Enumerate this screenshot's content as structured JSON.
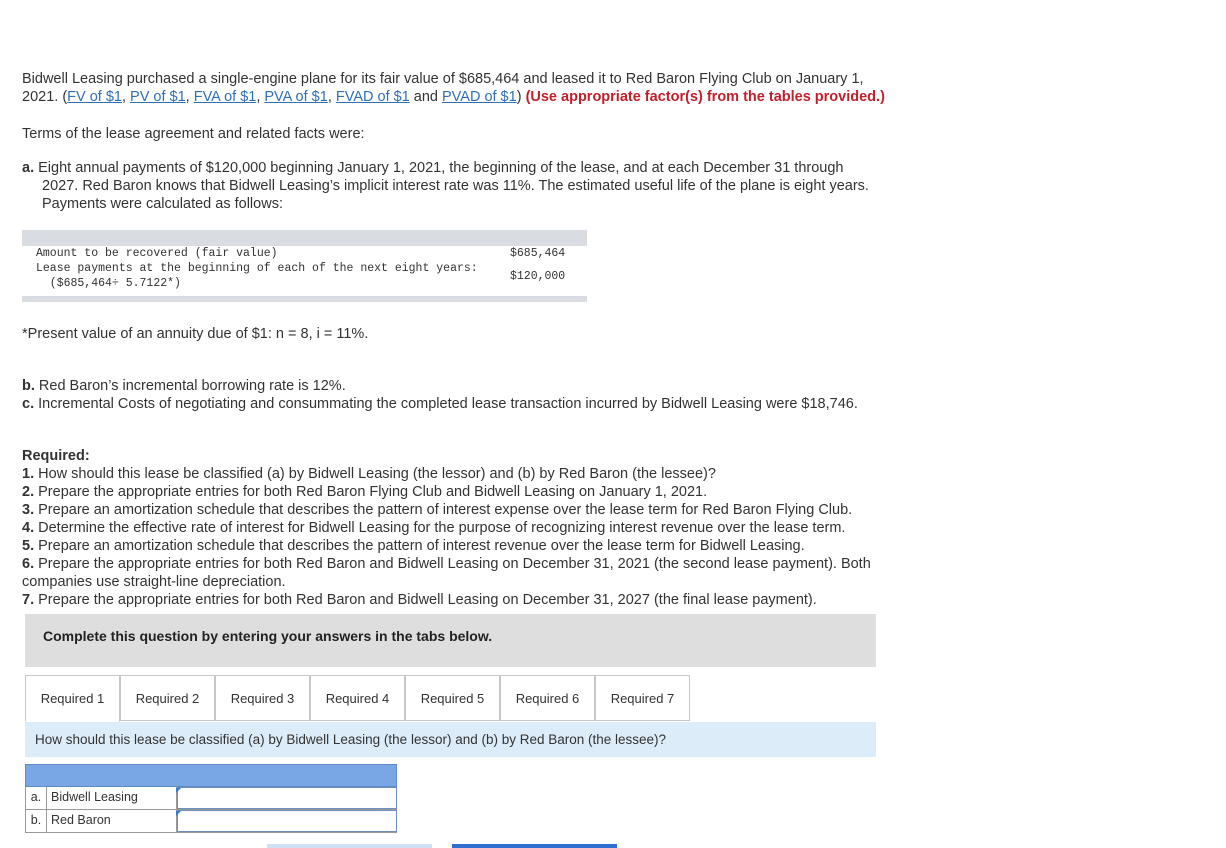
{
  "intro": {
    "line1": "Bidwell Leasing purchased a single-engine plane for its fair value of $685,464 and leased it to Red Baron Flying Club on January 1,",
    "line2_start": "2021. (",
    "links": [
      "FV of $1",
      "PV of $1",
      "FVA of $1",
      "PVA of $1",
      "FVAD of $1",
      "PVAD of $1"
    ],
    "sep": ", ",
    "and": " and ",
    "close": ") ",
    "instruction": "(Use appropriate factor(s) from the tables provided.)"
  },
  "terms_heading": "Terms of the lease agreement and related facts were:",
  "fact_a": {
    "letter": "a.",
    "line1": "Eight annual payments of $120,000 beginning January 1, 2021, the beginning of the lease, and at each December 31 through",
    "line2": "2027. Red Baron knows that Bidwell Leasing’s implicit interest rate was 11%. The estimated useful life of the plane is eight years.",
    "line3": "Payments were calculated as follows:"
  },
  "calc_table": {
    "row1_label": "Amount to be recovered (fair value)",
    "row1_value": "$685,464",
    "row2_label": "Lease payments at the beginning of each of the next eight years:",
    "row2_value": "$120,000",
    "row3_label": "  ($685,464÷ 5.7122*)"
  },
  "footnote": "*Present value of an annuity due of $1: n = 8, i = 11%.",
  "fact_b": {
    "letter": "b.",
    "text": "Red Baron’s incremental borrowing rate is 12%."
  },
  "fact_c": {
    "letter": "c.",
    "text": "Incremental Costs of negotiating and consummating the completed lease transaction incurred by Bidwell Leasing were $18,746."
  },
  "required": {
    "heading": "Required:",
    "items": [
      {
        "num": "1.",
        "text": "How should this lease be classified (a) by Bidwell Leasing (the lessor) and (b) by Red Baron (the lessee)?"
      },
      {
        "num": "2.",
        "text": "Prepare the appropriate entries for both Red Baron Flying Club and Bidwell Leasing on January 1, 2021."
      },
      {
        "num": "3.",
        "text": "Prepare an amortization schedule that describes the pattern of interest expense over the lease term for Red Baron Flying Club."
      },
      {
        "num": "4.",
        "text": "Determine the effective rate of interest for Bidwell Leasing for the purpose of recognizing interest revenue over the lease term."
      },
      {
        "num": "5.",
        "text": "Prepare an amortization schedule that describes the pattern of interest revenue over the lease term for Bidwell Leasing."
      },
      {
        "num": "6.",
        "text": "Prepare the appropriate entries for both Red Baron and Bidwell Leasing on December 31, 2021 (the second lease payment). Both"
      },
      {
        "num": "",
        "text": "companies use straight-line depreciation."
      },
      {
        "num": "7.",
        "text": "Prepare the appropriate entries for both Red Baron and Bidwell Leasing on December 31, 2027 (the final lease payment)."
      }
    ]
  },
  "complete_prompt": "Complete this question by entering your answers in the tabs below.",
  "tabs": [
    "Required 1",
    "Required 2",
    "Required 3",
    "Required 4",
    "Required 5",
    "Required 6",
    "Required 7"
  ],
  "active_tab": "Required 1",
  "question": "How should this lease be classified (a) by Bidwell Leasing (the lessor) and (b) by Red Baron (the lessee)?",
  "answer_rows": [
    {
      "letter": "a.",
      "label": "Bidwell Leasing",
      "value": ""
    },
    {
      "letter": "b.",
      "label": "Red Baron",
      "value": ""
    }
  ],
  "colors": {
    "link": "#2f6fb5",
    "instruction_red": "#c0202b",
    "table_header_blue": "#79a6e4",
    "question_bar": "#dcecf8",
    "complete_box": "#dedede",
    "next_button": "#2e6fd0"
  }
}
